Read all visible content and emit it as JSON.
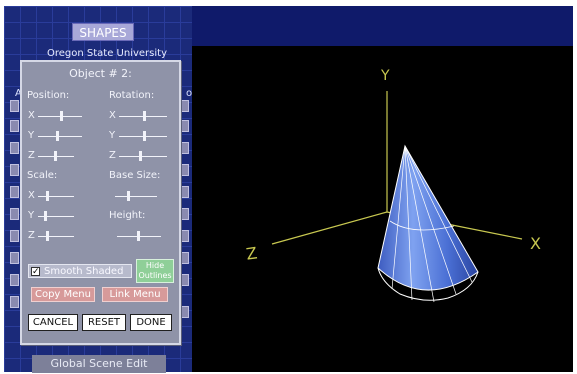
{
  "app": {
    "title": "SHAPES",
    "subtitle": "Oregon State University",
    "left_letter": "A",
    "right_letter": "o"
  },
  "dialog": {
    "title": "Object # 2:",
    "position_label": "Position:",
    "rotation_label": "Rotation:",
    "scale_label": "Scale:",
    "base_size_label": "Base Size:",
    "height_label": "Height:",
    "axes": {
      "x": "X",
      "y": "Y",
      "z": "Z"
    },
    "smooth_shaded_label": "Smooth Shaded",
    "smooth_shaded_checked": true,
    "check_mark": "✓",
    "hide_outlines_label_1": "Hide",
    "hide_outlines_label_2": "Outlines",
    "copy_menu_label": "Copy Menu",
    "link_menu_label": "Link Menu",
    "cancel_label": "CANCEL",
    "reset_label": "RESET",
    "done_label": "DONE"
  },
  "bottom_tab": "Global Scene Edit",
  "viewport": {
    "axis_y": "Y",
    "axis_z": "Z",
    "axis_x": "X",
    "axis_color": "#c8c850",
    "cone_color": "#5f86e0"
  },
  "colors": {
    "panel_blue": "#1b2a7a",
    "dialog_gray": "#8f93a8",
    "pink_button": "#d79a9a",
    "green_button": "#8fcf98"
  }
}
